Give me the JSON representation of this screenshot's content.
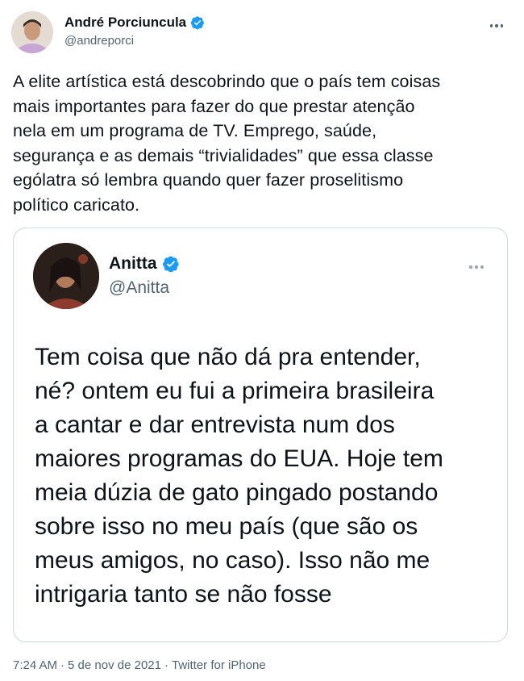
{
  "author": {
    "display_name": "André Porciuncula",
    "handle": "@andreporci"
  },
  "tweet_lines": [
    "A elite artística está descobrindo que o país tem coisas",
    "mais importantes para fazer do que prestar atenção",
    "nela em um programa de TV. Emprego, saúde,",
    "segurança e as demais “trivialidades” que essa classe",
    "ególatra só lembra quando quer fazer proselitismo",
    "político caricato."
  ],
  "quoted": {
    "display_name": "Anitta",
    "handle": "@Anitta",
    "lines": [
      "Tem coisa que não dá pra entender,",
      "né? ontem eu fui a primeira brasileira",
      "a cantar e dar entrevista num dos",
      "maiores programas do EUA. Hoje tem",
      "meia dúzia de gato pingado postando",
      "sobre isso no meu país (que são os",
      "meus amigos, no caso). Isso não me",
      "intrigaria tanto se não fosse"
    ]
  },
  "meta": {
    "time": "7:24 AM",
    "separator": "·",
    "date": "5 de nov de 2021",
    "source": "Twitter for iPhone"
  },
  "colors": {
    "verified": "#1d9bf0",
    "secondary_text": "#536471",
    "border": "#cfd9de"
  },
  "icons": [
    "verified-badge-icon",
    "more-options-icon"
  ]
}
